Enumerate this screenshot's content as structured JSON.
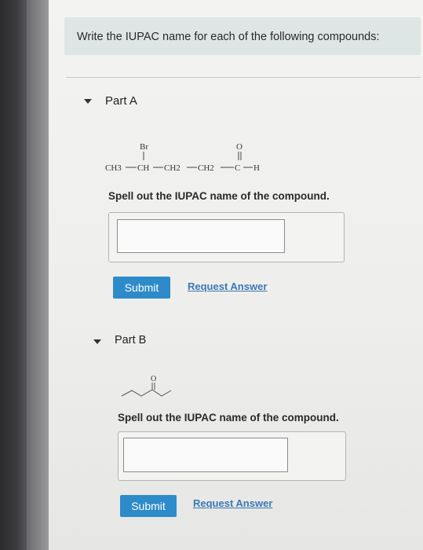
{
  "header": {
    "prompt": "Write the IUPAC name for each of the following compounds:"
  },
  "parts": [
    {
      "label": "Part A",
      "structure": {
        "top_labels": [
          "Br",
          "O"
        ],
        "chain": [
          "CH3",
          "CH",
          "CH2",
          "CH2",
          "C",
          "H"
        ]
      },
      "instruction": "Spell out the IUPAC name of the compound.",
      "answer_value": "",
      "submit_label": "Submit",
      "request_label": "Request Answer"
    },
    {
      "label": "Part B",
      "structure": {
        "top_labels": [
          "O"
        ]
      },
      "instruction": "Spell out the IUPAC name of the compound.",
      "answer_value": "",
      "submit_label": "Submit",
      "request_label": "Request Answer"
    }
  ],
  "colors": {
    "header_bg": "#dde6e4",
    "button": "#2e8bc9",
    "link": "#3b78b5"
  }
}
